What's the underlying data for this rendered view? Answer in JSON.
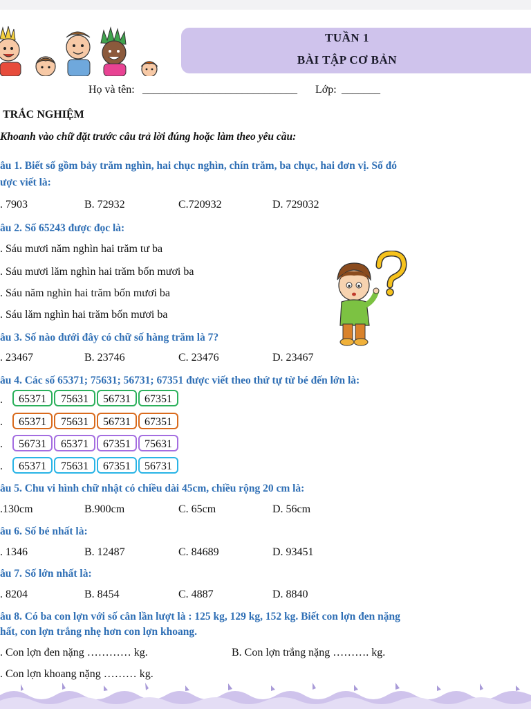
{
  "header": {
    "week": "TUẦN 1",
    "title": "BÀI TẬP CƠ BẢN",
    "name_label": "Họ và tên:",
    "name_blank": "____________________________",
    "class_label": "Lớp:",
    "class_blank": "_______"
  },
  "section": {
    "title": "TRẮC NGHIỆM",
    "instruction": "Khoanh vào chữ đặt trước câu trả lời đúng hoặc làm theo yêu cầu:"
  },
  "q1": {
    "line1": "âu 1. Biết số gồm bảy trăm nghìn, hai chục nghìn, chín trăm, ba chục, hai đơn vị. Số đó",
    "line2": "ược viết là:",
    "a": ". 7903",
    "b": "B. 72932",
    "c": "C.720932",
    "d": "D. 729032"
  },
  "q2": {
    "question": "âu 2. Số  65243 được đọc là:",
    "a": ". Sáu mươi năm nghìn hai trăm tư ba",
    "b": ". Sáu mươi lăm nghìn hai trăm bốn mươi ba",
    "c": ". Sáu năm nghìn hai trăm bốn mươi ba",
    "d": ". Sáu lăm nghìn hai trăm bốn mươi ba"
  },
  "q3": {
    "question": "âu 3. Số nào dưới đây có chữ số hàng trăm là 7?",
    "a": ". 23467",
    "b": "B. 23746",
    "c": "C. 23476",
    "d": "D. 23467"
  },
  "q4": {
    "question": "âu 4. Các số 65371; 75631; 56731; 67351  được viết theo thứ tự từ bé đến lớn là:",
    "bullet": ".",
    "rows": [
      [
        "65371",
        "75631",
        "56731",
        "67351"
      ],
      [
        "65371",
        "75631",
        "56731",
        "67351"
      ],
      [
        "56731",
        "65371",
        "67351",
        "75631"
      ],
      [
        "65371",
        "75631",
        "67351",
        "56731"
      ]
    ]
  },
  "q5": {
    "question": "âu 5. Chu vi hình chữ nhật có chiều dài 45cm, chiều rộng 20 cm là:",
    "a": ".130cm",
    "b": "B.900cm",
    "c": "C. 65cm",
    "d": "D. 56cm"
  },
  "q6": {
    "question": "âu 6. Số bé nhất là:",
    "a": ". 1346",
    "b": "B. 12487",
    "c": "C. 84689",
    "d": "D. 93451"
  },
  "q7": {
    "question": "âu 7. Số lớn nhất là:",
    "a": ". 8204",
    "b": "B. 8454",
    "c": "C. 4887",
    "d": "D. 8840"
  },
  "q8": {
    "line1": "âu 8. Có ba con lợn với số cân lần lượt là : 125 kg, 129 kg, 152 kg. Biết con lợn đen nặng",
    "line2": "hất, con lợn trắng nhẹ hơn con lợn khoang.",
    "a": ". Con lợn đen nặng ………… kg.",
    "b": "B. Con lợn trắng nặng ………. kg.",
    "c": ". Con lợn khoang nặng ……… kg."
  },
  "colors": {
    "question_blue": "#2f6fb5",
    "banner_lavender": "#cfc3ec",
    "box_green": "#2bb05b",
    "box_orange": "#d96a1c",
    "box_purple": "#a46de0",
    "box_cyan": "#29b4e6"
  },
  "icons": [
    "kids-illustration",
    "thinking-boy-illustration",
    "question-mark-icon",
    "wave-border"
  ]
}
